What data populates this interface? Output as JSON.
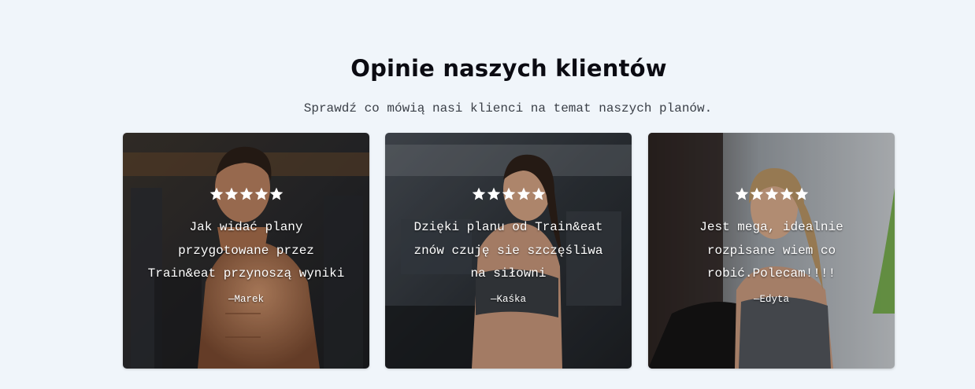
{
  "section": {
    "title": "Opinie naszych klientów",
    "subtitle": "Sprawdź co mówią nasi klienci na temat naszych planów."
  },
  "testimonials": [
    {
      "rating": 5,
      "quote": "Jak widać plany przygotowane przez Train&eat przynoszą wyniki",
      "author": "—Marek",
      "photo_icon": "man-at-gym-photo"
    },
    {
      "rating": 5,
      "quote": "Dzięki planu od Train&eat znów czuję sie szczęśliwa na siłowni",
      "author": "—Kaśka",
      "photo_icon": "woman-smiling-at-gym-photo"
    },
    {
      "rating": 5,
      "quote": "Jest mega, idealnie rozpisane wiem co robić.Polecam!!!!",
      "author": "—Edyta",
      "photo_icon": "woman-talking-at-gym-photo"
    }
  ],
  "colors": {
    "background": "#f0f5fa",
    "heading": "#0b0b12",
    "star": "#ffffff",
    "card_text": "#ffffff"
  }
}
